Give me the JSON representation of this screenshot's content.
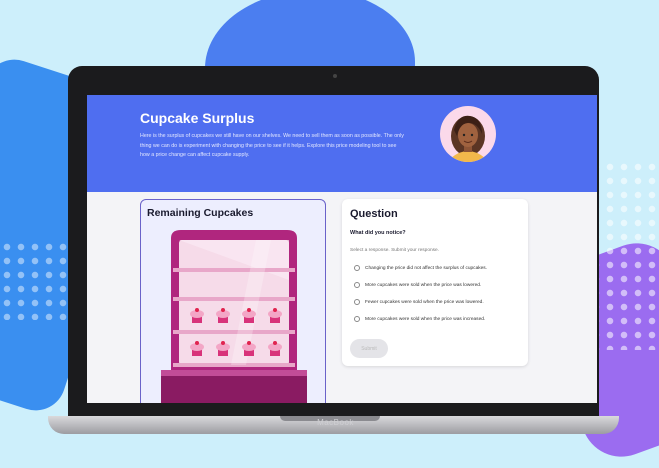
{
  "header": {
    "title": "Cupcake Surplus",
    "description": "Here is the surplus of cupcakes we still have on our shelves. We need to sell them as soon as possible. The only thing we can do is experiment with changing the price to see if it helps. Explore this price modeling tool to see how a price change can affect cupcake supply."
  },
  "remaining": {
    "title": "Remaining Cupcakes"
  },
  "question": {
    "title": "Question",
    "prompt": "What did you notice?",
    "instructions": "Select a response. Submit your response.",
    "options": [
      "Changing the price did not affect the surplus of cupcakes.",
      "More cupcakes were sold when the price was lowered.",
      "Fewer cupcakes were sold when the price was lowered.",
      "More cupcakes were sold when the price was increased."
    ],
    "submit_label": "Submit"
  },
  "device": {
    "brand": "MacBook"
  },
  "colors": {
    "header_bg": "#4f6ef0",
    "accent": "#6a62c9",
    "case": "#b0267e",
    "background": "#cdeffb"
  }
}
